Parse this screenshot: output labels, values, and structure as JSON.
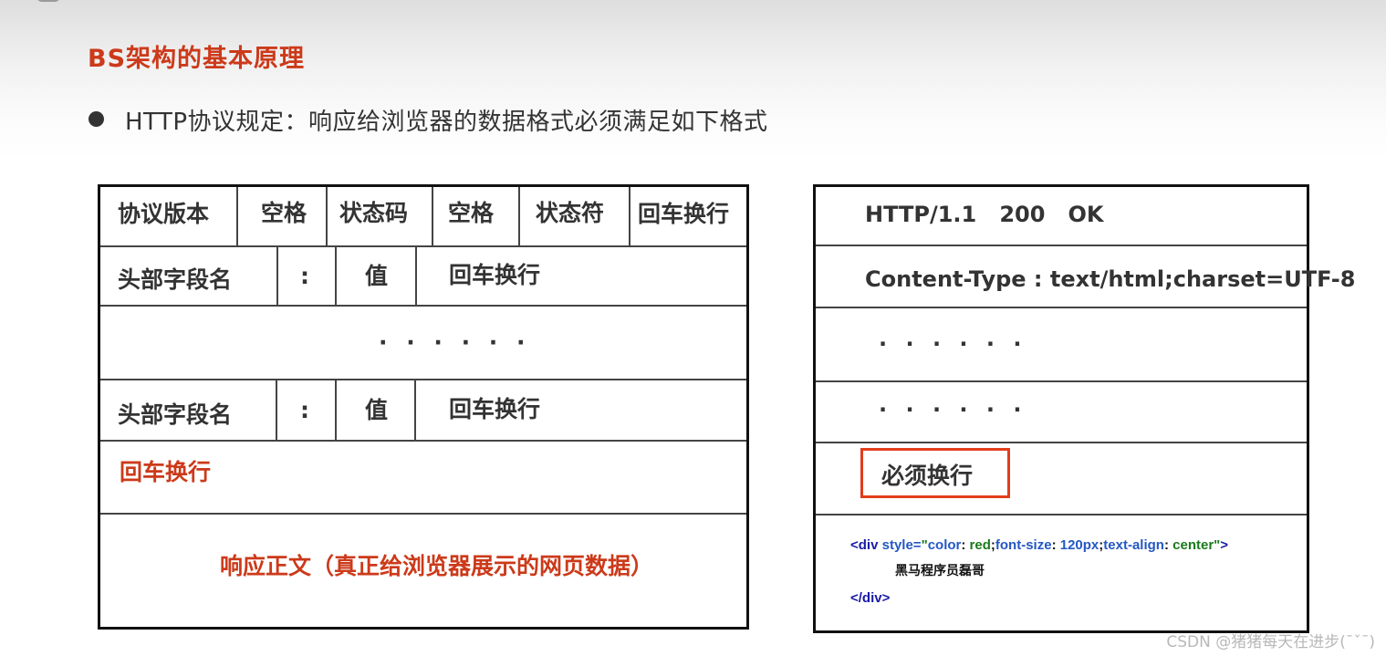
{
  "title": "BS架构的基本原理",
  "subtitle": "HTTP协议规定：响应给浏览器的数据格式必须满足如下格式",
  "left_table": {
    "row1": [
      "协议版本",
      "空格",
      "状态码",
      "空格",
      "状态符",
      "回车换行"
    ],
    "row2": [
      "头部字段名",
      ":",
      "值",
      "回车换行"
    ],
    "row3": "· · · · · ·",
    "row4": [
      "头部字段名",
      ":",
      "值",
      "回车换行"
    ],
    "row5": "回车换行",
    "row6": "响应正文（真正给浏览器展示的网页数据）"
  },
  "right_table": {
    "status_line": "HTTP/1.1   200   OK",
    "content_type": "Content-Type : text/html;charset=UTF-8",
    "dots1": "· · · · · ·",
    "dots2": "· · · · · ·",
    "must_newline": "必须换行",
    "code": {
      "open_tag": "<div",
      "attr_style": "style=",
      "q1": "\"",
      "p_color": "color",
      "colon1": ": ",
      "v_red": "red",
      "semi1": ";",
      "p_fontsize": "font-size",
      "colon2": ": ",
      "v_size": "120px",
      "semi2": ";",
      "p_align": "text-align",
      "colon3": ": ",
      "v_center": "center",
      "q2": "\"",
      "close_bracket": ">",
      "content": "黑马程序员磊哥",
      "close_tag": "</div>"
    }
  },
  "watermark": "CSDN @猪猪每天在进步(¯ˇ¯)"
}
